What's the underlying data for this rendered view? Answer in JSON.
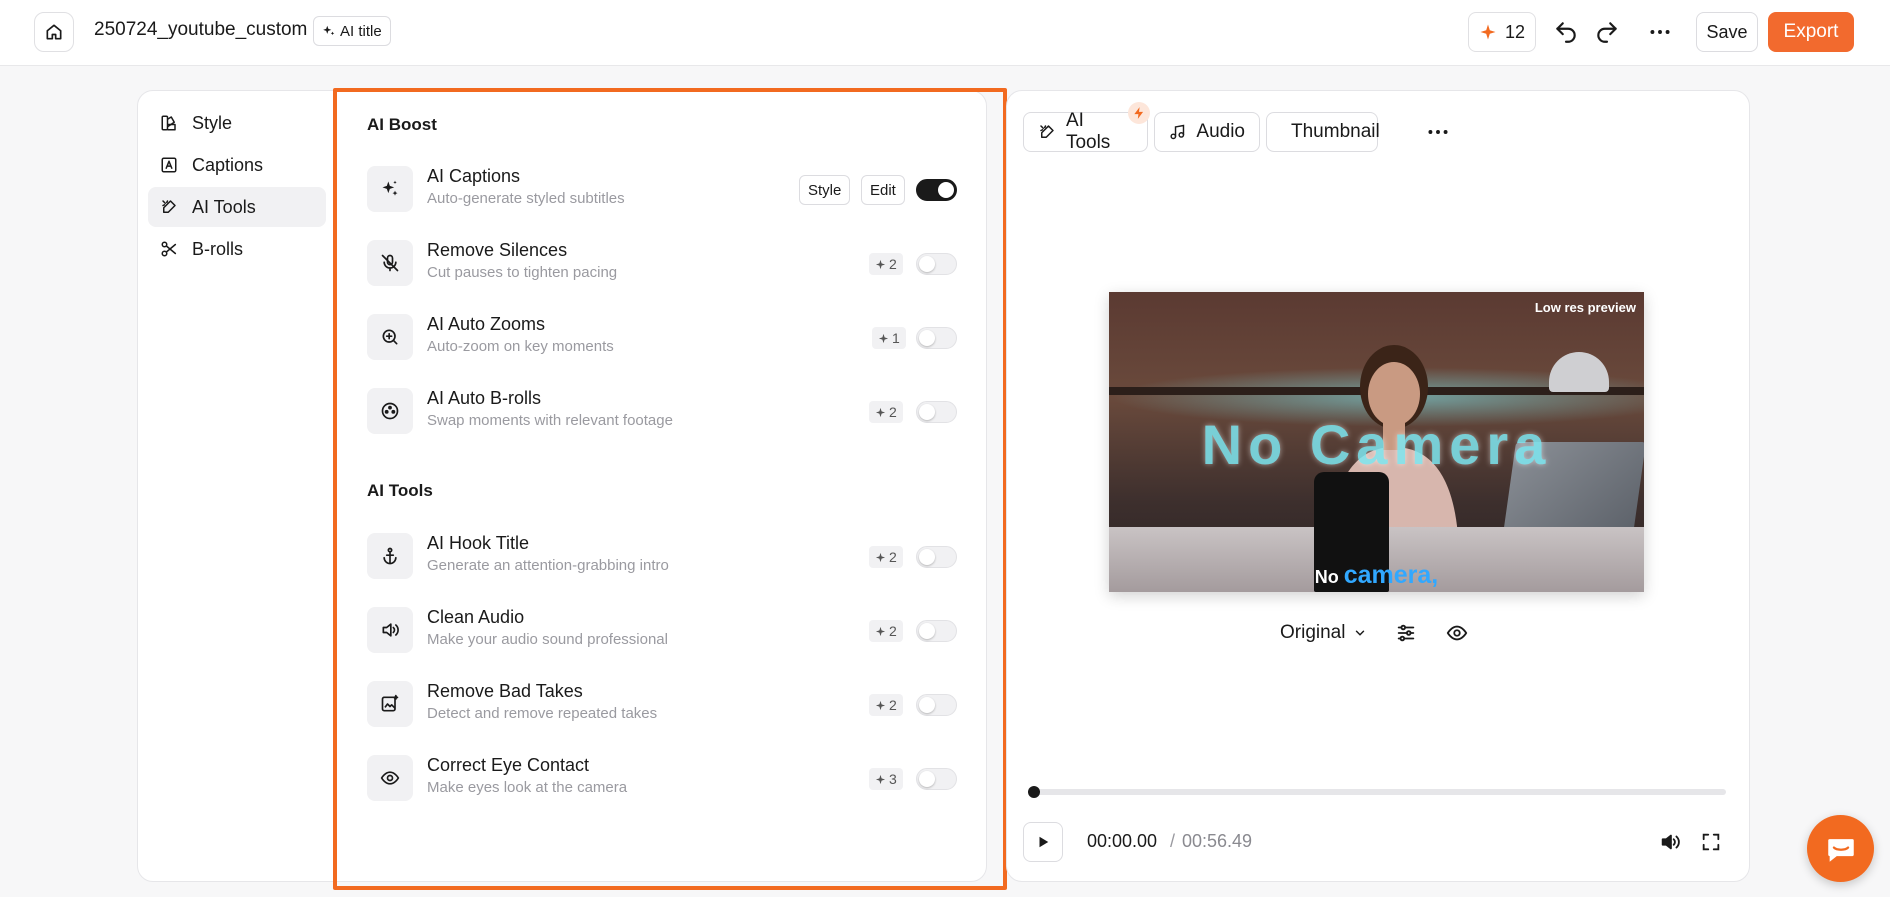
{
  "header": {
    "project_title": "250724_youtube_custom",
    "ai_title_label": "AI title",
    "credits": "12",
    "save_label": "Save",
    "export_label": "Export"
  },
  "sidebar": {
    "items": [
      {
        "label": "Style",
        "icon": "style-icon"
      },
      {
        "label": "Captions",
        "icon": "captions-icon"
      },
      {
        "label": "AI Tools",
        "icon": "ai-tools-icon",
        "active": true
      },
      {
        "label": "B-rolls",
        "icon": "scissors-icon"
      }
    ]
  },
  "ai_boost": {
    "title": "AI Boost",
    "items": [
      {
        "name": "AI Captions",
        "desc": "Auto-generate styled subtitles",
        "style_label": "Style",
        "edit_label": "Edit",
        "enabled": true
      },
      {
        "name": "Remove Silences",
        "desc": "Cut pauses to tighten pacing",
        "cost": "2",
        "enabled": false
      },
      {
        "name": "AI Auto Zooms",
        "desc": "Auto-zoom on key moments",
        "cost": "1",
        "enabled": false
      },
      {
        "name": "AI Auto B-rolls",
        "desc": "Swap moments with relevant footage",
        "cost": "2",
        "enabled": false
      }
    ]
  },
  "ai_tools": {
    "title": "AI Tools",
    "items": [
      {
        "name": "AI Hook Title",
        "desc": "Generate an attention-grabbing intro",
        "cost": "2",
        "enabled": false
      },
      {
        "name": "Clean Audio",
        "desc": "Make your audio sound professional",
        "cost": "2",
        "enabled": false
      },
      {
        "name": "Remove Bad Takes",
        "desc": "Detect and remove repeated takes",
        "cost": "2",
        "enabled": false
      },
      {
        "name": "Correct Eye Contact",
        "desc": "Make eyes look at the camera",
        "cost": "3",
        "enabled": false
      }
    ]
  },
  "preview_panel": {
    "tabs": [
      {
        "label": "AI Tools",
        "icon": "ai-tools-icon"
      },
      {
        "label": "Audio",
        "icon": "music-note-icon"
      },
      {
        "label": "Thumbnail",
        "icon": "thumbnail-icon"
      }
    ],
    "preview_label": "Low res preview",
    "overlay_text": "No Camera",
    "caption_prefix": "No",
    "caption_highlight": "camera,",
    "ratio_label": "Original",
    "progress": 0.0,
    "time_current": "00:00.00",
    "time_separator": "/",
    "time_total": "00:56.49"
  },
  "colors": {
    "accent": "#f26a20",
    "toggle_on": "#1a1a1a",
    "caption_highlight": "#31a8ff"
  }
}
